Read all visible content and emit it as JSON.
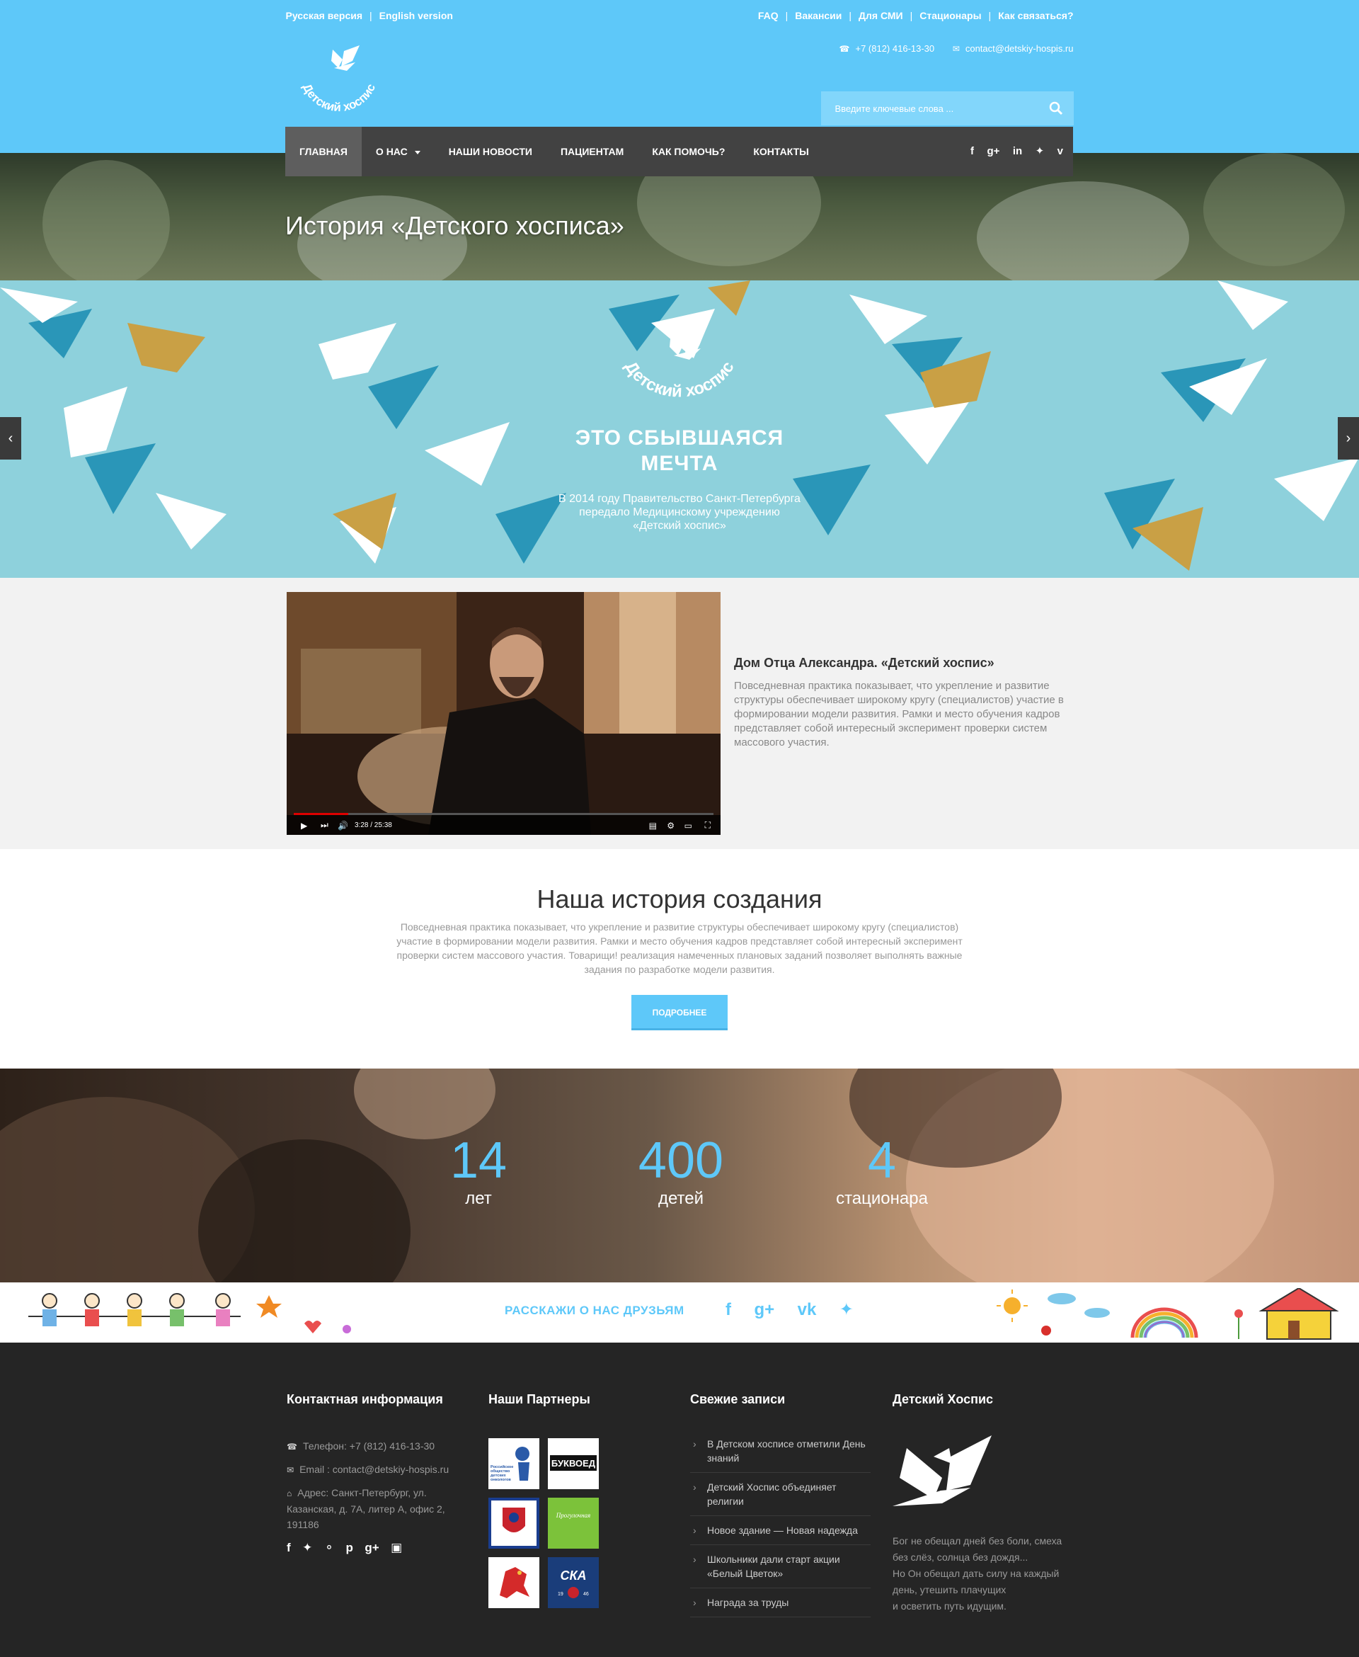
{
  "header": {
    "lang_links": [
      "Русская версия",
      "English version"
    ],
    "top_links": [
      "FAQ",
      "Вакансии",
      "Для СМИ",
      "Стационары",
      "Как связаться?"
    ],
    "phone": "+7 (812) 416-13-30",
    "email": "contact@detskiy-hospis.ru",
    "logo_text": "Детский хоспис",
    "search_placeholder": "Введите ключевые слова ..."
  },
  "nav": {
    "items": [
      "ГЛАВНАЯ",
      "О НАС",
      "НАШИ НОВОСТИ",
      "ПАЦИЕНТАМ",
      "КАК ПОМОЧЬ?",
      "КОНТАКТЫ"
    ],
    "active_index": 0,
    "social_icons": [
      "facebook-icon",
      "google-plus-icon",
      "linkedin-icon",
      "twitter-icon",
      "vimeo-icon"
    ]
  },
  "page_title": "История «Детского хосписа»",
  "slider": {
    "logo_text": "Детский хоспис",
    "headline_line1": "ЭТО СБЫВШАЯСЯ",
    "headline_line2": "МЕЧТА",
    "sub_line1": "В 2014 году Правительство Санкт-Петербурга",
    "sub_line2": "передало Медицинскому учреждению",
    "sub_line3": "«Детский хоспис»",
    "prev_icon": "chevron-left-icon",
    "next_icon": "chevron-right-icon"
  },
  "video": {
    "time": "3:28 / 25:38",
    "progress": 0.13,
    "title": "Дом Отца Александра. «Детский хоспис»",
    "text": "Повседневная практика показывает, что укрепление и развитие структуры обеспечивает широкому кругу (специалистов) участие в формировании модели развития. Рамки и место обучения кадров представляет собой интересный эксперимент проверки систем массового участия."
  },
  "history": {
    "title": "Наша история создания",
    "text": "Повседневная практика показывает, что укрепление и развитие структуры обеспечивает широкому кругу (специалистов) участие в формировании модели развития. Рамки и место обучения кадров представляет собой интересный эксперимент проверки систем массового участия. Товарищи! реализация намеченных плановых заданий позволяет выполнять важные задания по разработке модели развития.",
    "button": "ПОДРОБНЕЕ"
  },
  "counters": [
    {
      "value": "14",
      "label": "лет"
    },
    {
      "value": "400",
      "label": "детей"
    },
    {
      "value": "4",
      "label": "стационара"
    }
  ],
  "share": {
    "title": "РАССКАЖИ О НАС ДРУЗЬЯМ",
    "icons": [
      "facebook-icon",
      "google-plus-icon",
      "vk-icon",
      "twitter-icon"
    ]
  },
  "footer": {
    "contact": {
      "title": "Контактная информация",
      "phone": "Телефон: +7 (812) 416-13-30",
      "email": "Email : contact@detskiy-hospis.ru",
      "address_line1": "Адрес: Санкт-Петербург, ул.",
      "address_line2": "Казанская, д. 7А, литер А, офис 2,",
      "address_line3": "191186",
      "social_icons": [
        "facebook-icon",
        "twitter-icon",
        "dribbble-icon",
        "pinterest-icon",
        "google-plus-icon",
        "instagram-icon"
      ]
    },
    "partners": {
      "title": "Наши Партнеры",
      "logos": [
        "Российское общество детских онкологов",
        "БУКВОЕД",
        "герб",
        "Прогулочная",
        "грифон",
        "СКА"
      ]
    },
    "posts": {
      "title": "Свежие записи",
      "items": [
        "В Детском хосписе отметили День знаний",
        "Детский Хоспис объединяет религии",
        "Новое здание — Новая надежда",
        "Школьники дали старт акции «Белый Цветок»",
        "Награда за труды"
      ]
    },
    "about": {
      "title": "Детский Хоспис",
      "quote_line1": "Бог не обещал дней без боли, смеха",
      "quote_line2": "без слёз, солнца без дождя...",
      "quote_line3": "Но Он обещал дать силу на каждый",
      "quote_line4": "день, утешить плачущих",
      "quote_line5": "и осветить путь идущим."
    }
  }
}
